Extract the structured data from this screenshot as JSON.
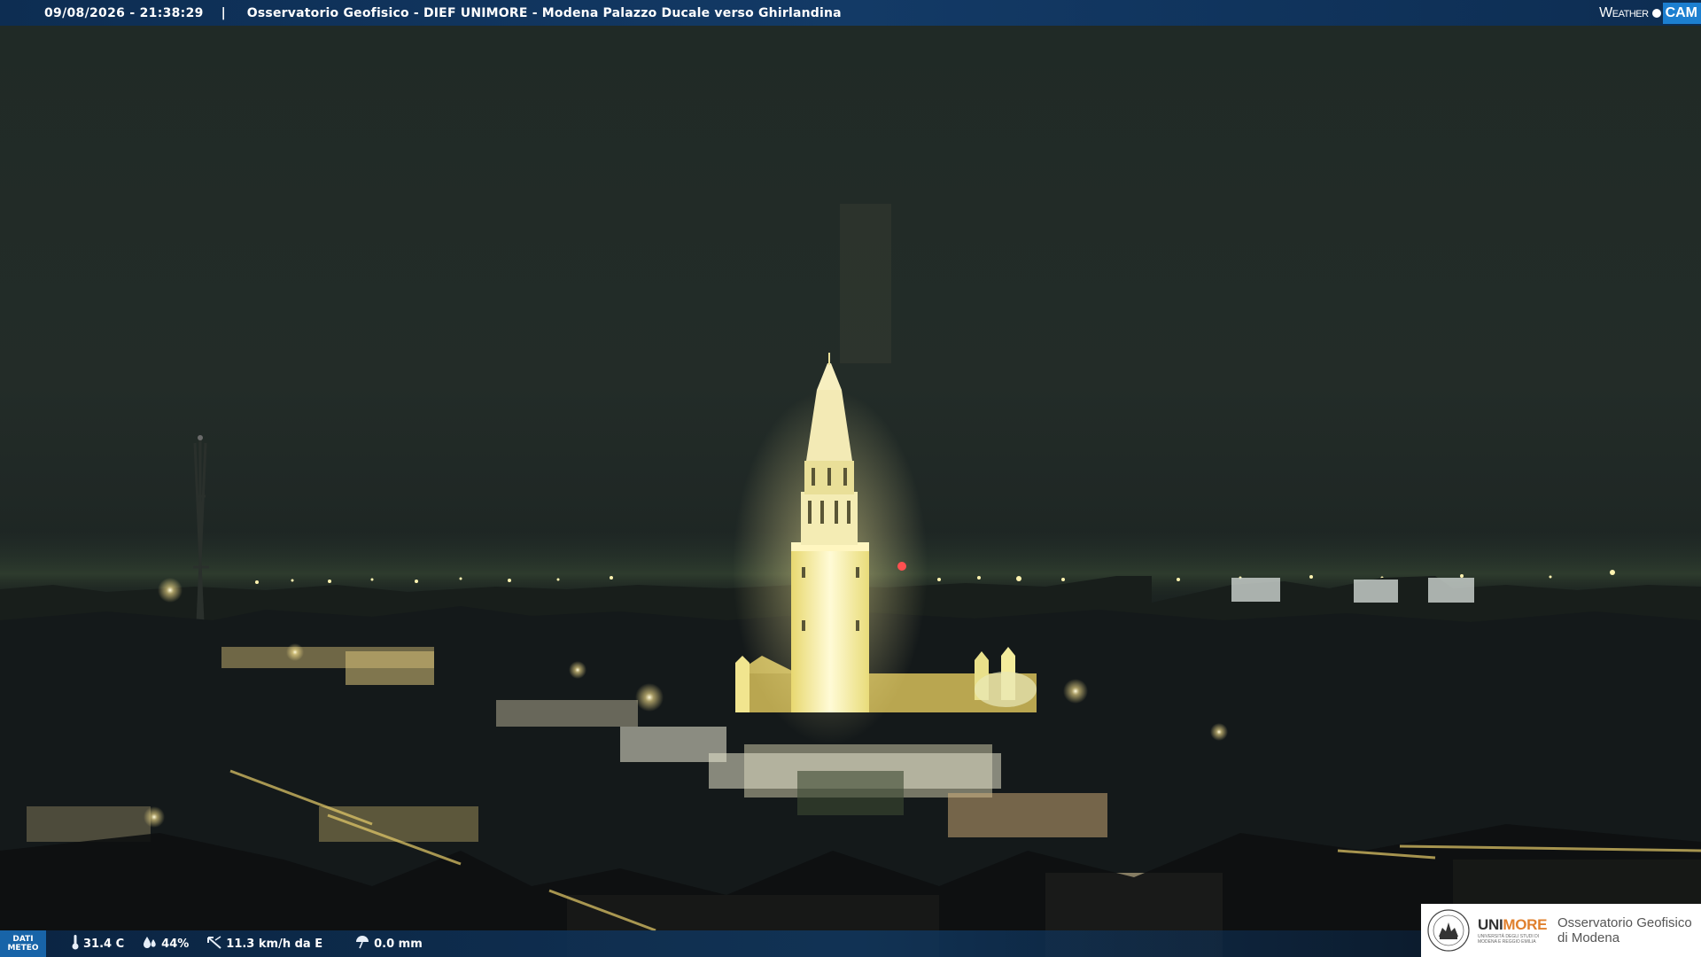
{
  "header": {
    "timestamp": "09/08/2026 - 21:38:29",
    "separator": "|",
    "title": "Osservatorio Geofisico - DIEF UNIMORE - Modena Palazzo Ducale verso Ghirlandina"
  },
  "brand": {
    "weather": "Weather",
    "cam": "CAM"
  },
  "meteo": {
    "label_line1": "DATI",
    "label_line2": "METEO",
    "temperature": "31.4 C",
    "humidity": "44%",
    "wind": "11.3 km/h da E",
    "rain": "0.0 mm"
  },
  "logo": {
    "uni": "UNI",
    "more": "MORE",
    "university_sub": "UNIVERSITÀ DEGLI STUDI DI MODENA E REGGIO EMILIA",
    "observatory_line1": "Osservatorio Geofisico",
    "observatory_line2": "di Modena"
  },
  "colors": {
    "top_bar": "#133a66",
    "cam_badge": "#1c7fd0",
    "more_accent": "#e0802e",
    "tower_light": "#fff6b8",
    "sky": "#222b27"
  },
  "icons": {
    "temperature": "thermometer-icon",
    "humidity": "drops-icon",
    "wind": "wind-icon",
    "rain": "rain-gauge-icon"
  }
}
